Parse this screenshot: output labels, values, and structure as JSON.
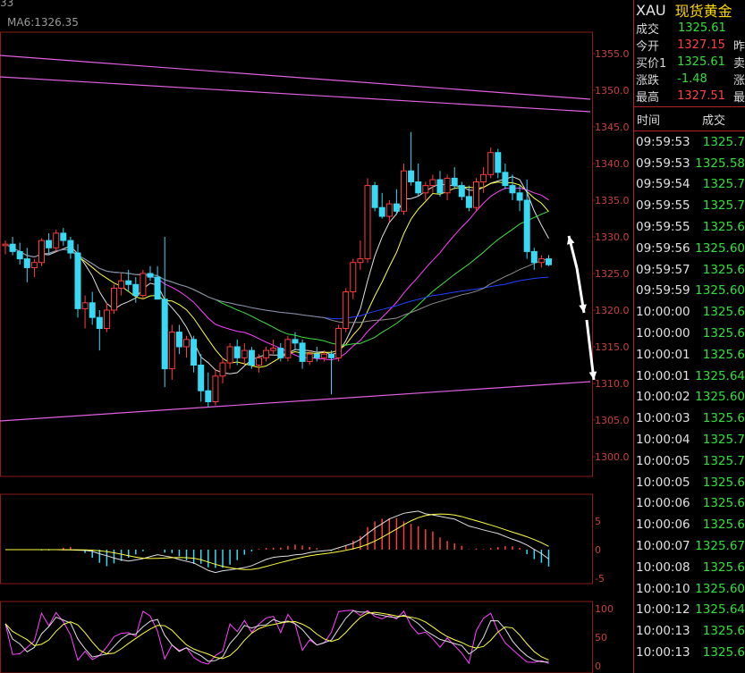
{
  "top_bar": {
    "left_text": "33",
    "ma_label": "MA6:1326.35"
  },
  "price_axis": [
    "1355.0",
    "1350.0",
    "1345.0",
    "1340.0",
    "1335.0",
    "1330.0",
    "1325.0",
    "1320.0",
    "1315.0",
    "1310.0",
    "1305.0",
    "1300.0"
  ],
  "macd_axis": [
    "5",
    "0",
    "-5"
  ],
  "kdj_axis": [
    "100",
    "50",
    "0"
  ],
  "colors": {
    "up": "#ff3b3b",
    "down": "#38d9f5",
    "ma_white": "#e0e0e0",
    "ma_yellow": "#ffff40",
    "ma_magenta": "#ff40ff",
    "ma_green": "#40e040",
    "ma_blue": "#2040ff",
    "ma_gray": "#909090",
    "trend": "#e060e0",
    "grid": "#8b1a1a"
  },
  "panel": {
    "symbol": "XAU",
    "name": "现货黄金",
    "quotes": [
      {
        "label": "成交",
        "value": "1325.61",
        "color": "green",
        "extra": ""
      },
      {
        "label": "今开",
        "value": "1327.15",
        "color": "red",
        "extra": "昨"
      },
      {
        "label": "买价1",
        "value": "1325.61",
        "color": "green",
        "extra": "卖"
      },
      {
        "label": "涨跌",
        "value": "-1.48",
        "color": "green",
        "extra": "涨"
      },
      {
        "label": "最高",
        "value": "1327.51",
        "color": "red",
        "extra": "最"
      }
    ],
    "tick_header": {
      "time": "时间",
      "price": "成交"
    },
    "ticks": [
      {
        "time": "09:59:53",
        "price": "1325.7"
      },
      {
        "time": "09:59:53",
        "price": "1325.58"
      },
      {
        "time": "09:59:54",
        "price": "1325.7"
      },
      {
        "time": "09:59:55",
        "price": "1325.7"
      },
      {
        "time": "09:59:55",
        "price": "1325.6"
      },
      {
        "time": "09:59:56",
        "price": "1325.60"
      },
      {
        "time": "09:59:57",
        "price": "1325.6"
      },
      {
        "time": "09:59:59",
        "price": "1325.60"
      },
      {
        "time": "10:00:00",
        "price": "1325.6"
      },
      {
        "time": "10:00:00",
        "price": "1325.6"
      },
      {
        "time": "10:00:01",
        "price": "1325.6"
      },
      {
        "time": "10:00:01",
        "price": "1325.64"
      },
      {
        "time": "10:00:02",
        "price": "1325.60"
      },
      {
        "time": "10:00:03",
        "price": "1325.6"
      },
      {
        "time": "10:00:04",
        "price": "1325.7"
      },
      {
        "time": "10:00:05",
        "price": "1325.7"
      },
      {
        "time": "10:00:05",
        "price": "1325.6"
      },
      {
        "time": "10:00:06",
        "price": "1325.6"
      },
      {
        "time": "10:00:06",
        "price": "1325.6"
      },
      {
        "time": "10:00:07",
        "price": "1325.67"
      },
      {
        "time": "10:00:08",
        "price": "1325.6"
      },
      {
        "time": "10:00:10",
        "price": "1325.60"
      },
      {
        "time": "10:00:12",
        "price": "1325.64"
      },
      {
        "time": "10:00:13",
        "price": "1325.6"
      },
      {
        "time": "10:00:13",
        "price": "1325.6"
      }
    ]
  },
  "candles": [
    [
      1328.8,
      1329.5,
      1327.6,
      1329.0
    ],
    [
      1329.0,
      1330.0,
      1327.5,
      1328.0
    ],
    [
      1328.0,
      1329.2,
      1326.2,
      1327.0
    ],
    [
      1327.0,
      1328.5,
      1323.8,
      1325.8
    ],
    [
      1325.8,
      1327.0,
      1324.5,
      1326.5
    ],
    [
      1326.5,
      1329.8,
      1326.0,
      1329.5
    ],
    [
      1329.5,
      1330.5,
      1327.5,
      1328.5
    ],
    [
      1328.5,
      1331.0,
      1328.0,
      1330.5
    ],
    [
      1330.5,
      1331.2,
      1328.8,
      1329.5
    ],
    [
      1329.5,
      1330.0,
      1327.0,
      1327.8
    ],
    [
      1327.8,
      1329.0,
      1319.0,
      1320.2
    ],
    [
      1320.2,
      1322.0,
      1317.5,
      1321.0
    ],
    [
      1321.0,
      1322.5,
      1318.0,
      1319.0
    ],
    [
      1319.0,
      1320.0,
      1314.5,
      1317.5
    ],
    [
      1317.5,
      1321.0,
      1317.0,
      1320.0
    ],
    [
      1320.0,
      1323.5,
      1319.5,
      1323.0
    ],
    [
      1323.0,
      1325.0,
      1322.0,
      1324.0
    ],
    [
      1324.0,
      1325.5,
      1322.5,
      1323.5
    ],
    [
      1323.5,
      1324.5,
      1321.0,
      1322.0
    ],
    [
      1322.0,
      1325.5,
      1321.5,
      1325.0
    ],
    [
      1325.0,
      1326.0,
      1324.0,
      1324.5
    ],
    [
      1324.5,
      1326.0,
      1321.5,
      1321.5
    ],
    [
      1321.5,
      1330.0,
      1309.5,
      1312.0
    ],
    [
      1312.0,
      1318.0,
      1310.5,
      1317.0
    ],
    [
      1317.0,
      1318.0,
      1314.0,
      1315.0
    ],
    [
      1315.0,
      1316.5,
      1313.5,
      1316.0
    ],
    [
      1316.0,
      1316.5,
      1311.5,
      1312.5
    ],
    [
      1312.5,
      1314.0,
      1307.5,
      1309.0
    ],
    [
      1309.0,
      1311.5,
      1306.8,
      1307.5
    ],
    [
      1307.5,
      1312.0,
      1307.0,
      1311.0
    ],
    [
      1311.0,
      1313.5,
      1310.0,
      1312.8
    ],
    [
      1312.8,
      1315.5,
      1312.0,
      1315.0
    ],
    [
      1315.0,
      1316.0,
      1312.5,
      1313.5
    ],
    [
      1313.5,
      1315.5,
      1312.5,
      1314.5
    ],
    [
      1314.5,
      1315.0,
      1312.0,
      1312.5
    ],
    [
      1312.5,
      1314.0,
      1311.5,
      1313.5
    ],
    [
      1313.5,
      1315.0,
      1313.0,
      1314.5
    ],
    [
      1314.5,
      1316.0,
      1314.0,
      1314.8
    ],
    [
      1314.8,
      1315.5,
      1313.0,
      1313.5
    ],
    [
      1313.5,
      1316.5,
      1313.0,
      1316.0
    ],
    [
      1316.0,
      1317.0,
      1314.5,
      1315.5
    ],
    [
      1315.5,
      1316.0,
      1312.0,
      1313.0
    ],
    [
      1313.0,
      1314.5,
      1312.5,
      1314.0
    ],
    [
      1314.0,
      1315.0,
      1313.0,
      1313.5
    ],
    [
      1313.5,
      1314.5,
      1313.0,
      1314.0
    ],
    [
      1314.0,
      1314.5,
      1308.5,
      1313.5
    ],
    [
      1313.5,
      1318.0,
      1313.0,
      1317.5
    ],
    [
      1317.5,
      1323.0,
      1317.0,
      1322.5
    ],
    [
      1322.5,
      1327.0,
      1321.5,
      1326.5
    ],
    [
      1326.5,
      1329.5,
      1325.5,
      1327.0
    ],
    [
      1327.0,
      1338.0,
      1326.5,
      1337.0
    ],
    [
      1337.0,
      1337.5,
      1333.5,
      1334.0
    ],
    [
      1334.0,
      1336.0,
      1332.5,
      1332.8
    ],
    [
      1332.8,
      1335.0,
      1332.0,
      1334.5
    ],
    [
      1334.5,
      1336.5,
      1333.0,
      1333.5
    ],
    [
      1333.5,
      1340.0,
      1333.0,
      1339.0
    ],
    [
      1339.0,
      1344.3,
      1337.0,
      1337.5
    ],
    [
      1337.5,
      1340.0,
      1335.5,
      1336.0
    ],
    [
      1336.0,
      1337.5,
      1335.0,
      1337.0
    ],
    [
      1337.0,
      1338.5,
      1336.0,
      1337.8
    ],
    [
      1337.8,
      1339.0,
      1335.5,
      1336.0
    ],
    [
      1336.0,
      1338.5,
      1335.0,
      1338.0
    ],
    [
      1338.0,
      1339.5,
      1336.5,
      1337.0
    ],
    [
      1337.0,
      1337.5,
      1335.0,
      1335.5
    ],
    [
      1335.5,
      1337.0,
      1333.5,
      1334.0
    ],
    [
      1334.0,
      1338.0,
      1333.5,
      1337.5
    ],
    [
      1337.5,
      1339.5,
      1336.0,
      1338.5
    ],
    [
      1338.5,
      1342.2,
      1338.0,
      1341.5
    ],
    [
      1341.5,
      1342.0,
      1338.0,
      1338.8
    ],
    [
      1338.8,
      1340.0,
      1336.5,
      1337.0
    ],
    [
      1337.0,
      1338.5,
      1335.0,
      1336.0
    ],
    [
      1336.0,
      1337.0,
      1333.5,
      1335.0
    ],
    [
      1335.0,
      1337.8,
      1327.0,
      1328.0
    ],
    [
      1328.0,
      1328.5,
      1325.5,
      1326.5
    ],
    [
      1326.5,
      1327.5,
      1325.8,
      1327.0
    ],
    [
      1327.0,
      1327.5,
      1326.0,
      1326.2
    ]
  ]
}
